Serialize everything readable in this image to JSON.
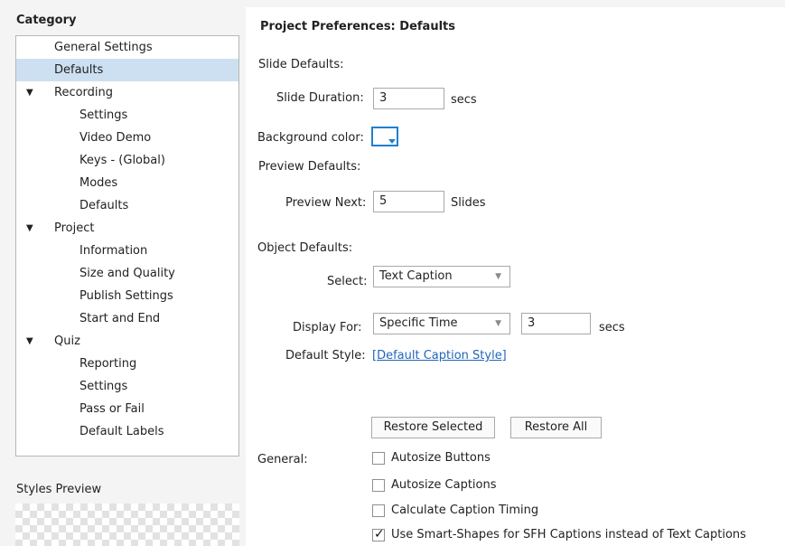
{
  "category": {
    "title": "Category",
    "items": [
      {
        "label": "General Settings"
      },
      {
        "label": "Defaults"
      },
      {
        "label": "Recording"
      },
      {
        "label": "Settings"
      },
      {
        "label": "Video Demo"
      },
      {
        "label": "Keys - (Global)"
      },
      {
        "label": "Modes"
      },
      {
        "label": "Defaults"
      },
      {
        "label": "Project"
      },
      {
        "label": "Information"
      },
      {
        "label": "Size and Quality"
      },
      {
        "label": "Publish Settings"
      },
      {
        "label": "Start and End"
      },
      {
        "label": "Quiz"
      },
      {
        "label": "Reporting"
      },
      {
        "label": "Settings"
      },
      {
        "label": "Pass or Fail"
      },
      {
        "label": "Default Labels"
      }
    ],
    "expand_icon": "triangle-down-icon"
  },
  "styles_preview": {
    "label": "Styles Preview"
  },
  "main": {
    "title": "Project Preferences: Defaults",
    "slide_defaults": {
      "heading": "Slide Defaults:",
      "duration_label": "Slide Duration:",
      "duration_value": "3",
      "duration_unit": "secs",
      "bg_color_label": "Background color:",
      "bg_color_value": "#ffffff"
    },
    "preview_defaults": {
      "heading": "Preview Defaults:",
      "next_label": "Preview Next:",
      "next_value": "5",
      "next_unit": "Slides"
    },
    "object_defaults": {
      "heading": "Object Defaults:",
      "select_label": "Select:",
      "select_value": "Text Caption",
      "display_for_label": "Display For:",
      "display_for_value": "Specific Time",
      "display_time_value": "3",
      "display_time_unit": "secs",
      "default_style_label": "Default Style:",
      "default_style_value": "[Default Caption Style]"
    },
    "buttons": {
      "restore_selected": "Restore Selected",
      "restore_all": "Restore All"
    },
    "general": {
      "label": "General:",
      "options": [
        {
          "label": "Autosize Buttons",
          "checked": false
        },
        {
          "label": "Autosize Captions",
          "checked": false
        },
        {
          "label": "Calculate Caption Timing",
          "checked": false
        },
        {
          "label": "Use Smart-Shapes for SFH Captions instead of Text Captions",
          "checked": true
        }
      ]
    }
  },
  "colors": {
    "accent": "#1f7fd0",
    "selection": "#cde0f2",
    "link": "#2166b8"
  }
}
